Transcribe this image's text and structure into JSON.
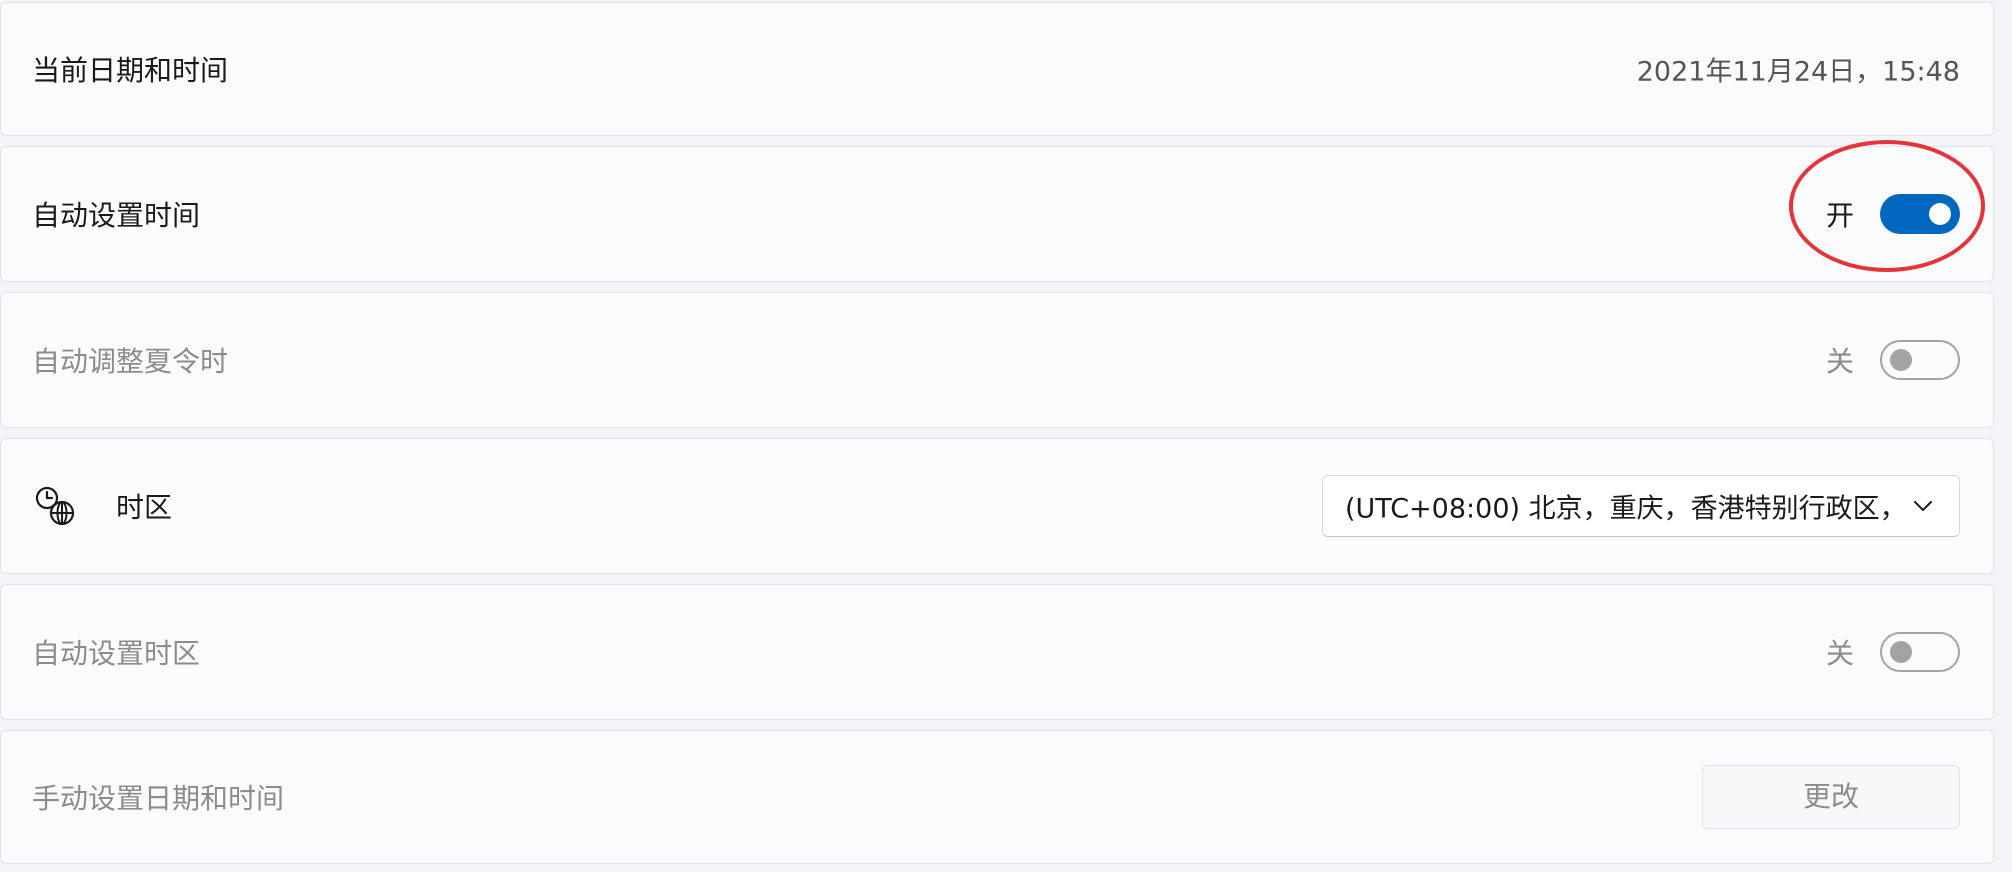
{
  "current_datetime": {
    "label": "当前日期和时间",
    "value": "2021年11月24日，15:48"
  },
  "auto_set_time": {
    "label": "自动设置时间",
    "state": "开",
    "on": true
  },
  "auto_dst": {
    "label": "自动调整夏令时",
    "state": "关",
    "on": false
  },
  "time_zone": {
    "icon": "clock-globe-icon",
    "label": "时区",
    "selected": "(UTC+08:00) 北京，重庆，香港特别行政区，"
  },
  "auto_set_timezone": {
    "label": "自动设置时区",
    "state": "关",
    "on": false
  },
  "manual_set": {
    "label": "手动设置日期和时间",
    "button": "更改"
  },
  "colors": {
    "accent": "#0067c0",
    "annotation": "#e5343a",
    "disabled_text": "#8c8c8c"
  }
}
